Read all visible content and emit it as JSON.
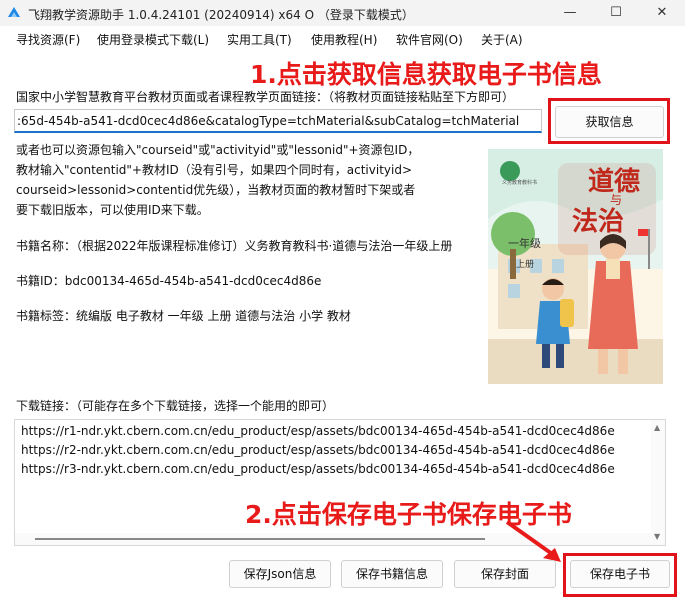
{
  "window": {
    "title": "飞翔教学资源助手 1.0.4.24101 (20240914) x64 O （登录下载模式）",
    "minimize_icon": "minimize-icon",
    "maximize_icon": "maximize-icon",
    "close_icon": "close-icon"
  },
  "menu": {
    "items": [
      {
        "label": "寻找资源(F)"
      },
      {
        "label": "使用登录模式下载(L)"
      },
      {
        "label": "实用工具(T)"
      },
      {
        "label": "使用教程(H)"
      },
      {
        "label": "软件官网(O)"
      },
      {
        "label": "关于(A)"
      }
    ]
  },
  "url_section": {
    "prompt": "国家中小学智慧教育平台教材页面或者课程教学页面链接：（将教材页面链接粘贴至下方即可）",
    "value": ":65d-454b-a541-dcd0cec4d86e&catalogType=tchMaterial&subCatalog=tchMaterial",
    "fetch_button": "获取信息"
  },
  "help_text": [
    "或者也可以资源包输入\"courseid\"或\"activityid\"或\"lessonid\"+资源包ID，",
    "教材输入\"contentid\"+教材ID（没有引号，如果四个同时有，activityid>",
    "courseid>lessonid>contentid优先级），当教材页面的教材暂时下架或者",
    "要下载旧版本，可以使用ID来下载。"
  ],
  "book": {
    "name": "书籍名称：（根据2022年版课程标准修订）义务教育教科书·道德与法治一年级上册",
    "id": "书籍ID：bdc00134-465d-454b-a541-dcd0cec4d86e",
    "tags": "书籍标签：统编版 电子教材 一年级 上册 道德与法治 小学 教材",
    "cover": {
      "title_top": "道德",
      "title_mid": "与",
      "title_bottom": "法治",
      "grade": "一年级",
      "volume": "上册",
      "series": "义务教育教科书"
    }
  },
  "downloads": {
    "label": "下载链接：（可能存在多个下载链接，选择一个能用的即可）",
    "links": [
      "https://r1-ndr.ykt.cbern.com.cn/edu_product/esp/assets/bdc00134-465d-454b-a541-dcd0cec4d86e",
      "https://r2-ndr.ykt.cbern.com.cn/edu_product/esp/assets/bdc00134-465d-454b-a541-dcd0cec4d86e",
      "https://r3-ndr.ykt.cbern.com.cn/edu_product/esp/assets/bdc00134-465d-454b-a541-dcd0cec4d86e"
    ]
  },
  "buttons": {
    "save_json": "保存Json信息",
    "save_book_info": "保存书籍信息",
    "save_cover": "保存封面",
    "save_ebook": "保存电子书"
  },
  "annotations": {
    "step1": "1.点击获取信息获取电子书信息",
    "step2": "2.点击保存电子书保存电子书"
  },
  "colors": {
    "annotation_red": "#e81a1a",
    "input_focus_blue": "#1a73c8"
  }
}
